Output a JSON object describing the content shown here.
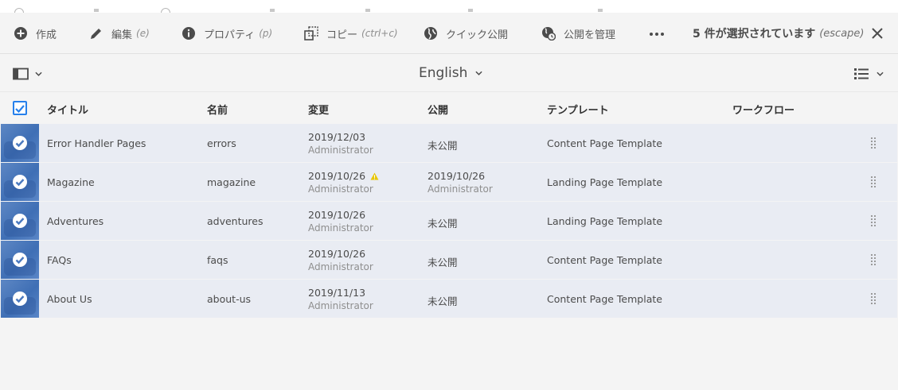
{
  "toolbar": {
    "create_label": "作成",
    "edit_label": "編集",
    "edit_shortcut": "(e)",
    "properties_label": "プロパティ",
    "properties_shortcut": "(p)",
    "copy_label": "コピー",
    "copy_shortcut": "(ctrl+c)",
    "quick_publish_label": "クイック公開",
    "manage_publication_label": "公開を管理",
    "more_icon": "more-icon",
    "selection_text": "5 件が選択されています",
    "selection_shortcut": "(escape)",
    "close_icon": "close-icon"
  },
  "viewbar": {
    "rail_toggle_icon": "rail-toggle-icon",
    "language": "English",
    "view_switch_icon": "list-view-icon"
  },
  "table": {
    "columns": [
      "タイトル",
      "名前",
      "変更",
      "公開",
      "テンプレート",
      "ワークフロー"
    ],
    "rows": [
      {
        "title": "Error Handler Pages",
        "name": "errors",
        "modified_date": "2019/12/03",
        "modified_by": "Administrator",
        "modified_warning": false,
        "published": "未公開",
        "published_by": "",
        "template": "Content Page Template",
        "workflow": ""
      },
      {
        "title": "Magazine",
        "name": "magazine",
        "modified_date": "2019/10/26",
        "modified_by": "Administrator",
        "modified_warning": true,
        "published": "2019/10/26",
        "published_by": "Administrator",
        "template": "Landing Page Template",
        "workflow": ""
      },
      {
        "title": "Adventures",
        "name": "adventures",
        "modified_date": "2019/10/26",
        "modified_by": "Administrator",
        "modified_warning": false,
        "published": "未公開",
        "published_by": "",
        "template": "Landing Page Template",
        "workflow": ""
      },
      {
        "title": "FAQs",
        "name": "faqs",
        "modified_date": "2019/10/26",
        "modified_by": "Administrator",
        "modified_warning": false,
        "published": "未公開",
        "published_by": "",
        "template": "Content Page Template",
        "workflow": ""
      },
      {
        "title": "About Us",
        "name": "about-us",
        "modified_date": "2019/11/13",
        "modified_by": "Administrator",
        "modified_warning": false,
        "published": "未公開",
        "published_by": "",
        "template": "Content Page Template",
        "workflow": ""
      }
    ]
  },
  "colors": {
    "accent": "#2680eb",
    "row_selected_bg": "#e9ecf3",
    "thumb_selected": "#4a79bf",
    "warning": "#e8c600"
  }
}
